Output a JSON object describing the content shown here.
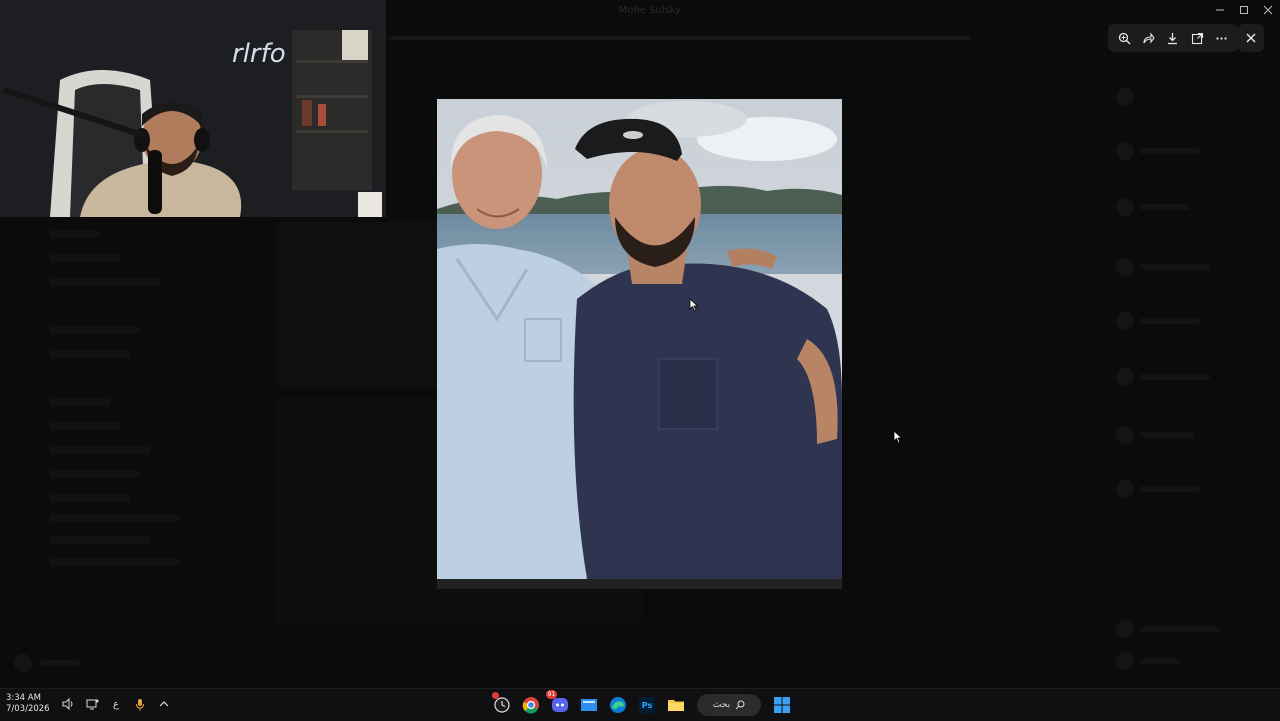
{
  "window": {
    "title": "Mohe Sulsky"
  },
  "viewer": {
    "tools": [
      {
        "icon": "zoom-in-icon"
      },
      {
        "icon": "share-icon"
      },
      {
        "icon": "download-icon"
      },
      {
        "icon": "open-external-icon"
      },
      {
        "icon": "more-options-icon"
      }
    ],
    "close_icon": "close-icon"
  },
  "taskbar": {
    "time": "3:34 AM",
    "date": "7/03/2026",
    "language": "ع",
    "search_label": "بحث",
    "pinned_apps": [
      {
        "name": "clock-app-icon"
      },
      {
        "name": "chrome-icon"
      },
      {
        "name": "discord-icon",
        "badge": "91"
      },
      {
        "name": "task-view-icon"
      },
      {
        "name": "edge-icon"
      },
      {
        "name": "photoshop-icon",
        "label": "Ps"
      },
      {
        "name": "file-explorer-icon"
      }
    ]
  },
  "colors": {
    "background": "#050505",
    "toolbar": "#1c1c1e",
    "taskbar": "#101012",
    "accent_blue": "#2f8cf0"
  }
}
